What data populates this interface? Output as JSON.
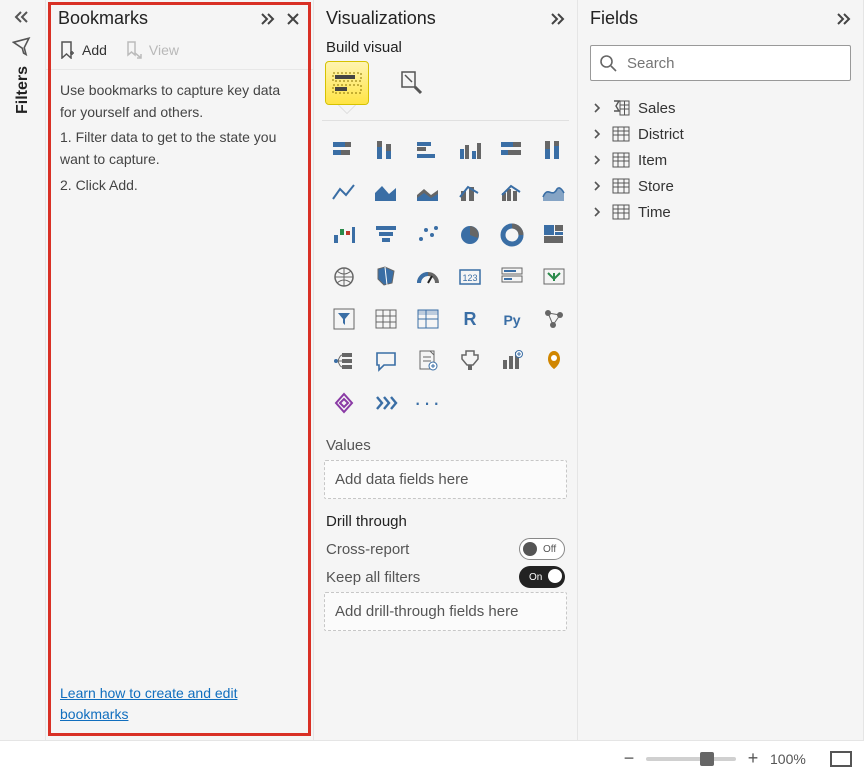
{
  "filters_rail": {
    "label": "Filters"
  },
  "bookmarks": {
    "title": "Bookmarks",
    "add_label": "Add",
    "view_label": "View",
    "hint_intro": "Use bookmarks to capture key data for yourself and others.",
    "hint_step1": "1. Filter data to get to the state you want to capture.",
    "hint_step2": "2. Click Add.",
    "learn_link": "Learn how to create and edit bookmarks"
  },
  "viz": {
    "title": "Visualizations",
    "subtitle": "Build visual",
    "values_label": "Values",
    "values_placeholder": "Add data fields here",
    "drill_label": "Drill through",
    "cross_report_label": "Cross-report",
    "cross_report_state": "Off",
    "keep_filters_label": "Keep all filters",
    "keep_filters_state": "On",
    "drill_placeholder": "Add drill-through fields here",
    "icons": [
      "stacked-bar",
      "stacked-column",
      "clustered-bar",
      "clustered-column",
      "stacked-bar-100",
      "stacked-column-100",
      "line",
      "area",
      "stacked-area",
      "line-stacked-column",
      "line-clustered-column",
      "ribbon",
      "waterfall",
      "funnel",
      "scatter",
      "pie",
      "donut",
      "treemap",
      "map",
      "filled-map",
      "gauge",
      "card",
      "multi-row-card",
      "kpi",
      "slicer",
      "table",
      "matrix",
      "r-visual",
      "py-visual",
      "key-influencers",
      "decomposition",
      "chat",
      "paginated",
      "goals",
      "metrics",
      "narrative",
      "appsource",
      "getmore"
    ]
  },
  "fields": {
    "title": "Fields",
    "search_placeholder": "Search",
    "items": [
      {
        "label": "Sales",
        "icon": "sigma-table"
      },
      {
        "label": "District",
        "icon": "table"
      },
      {
        "label": "Item",
        "icon": "table"
      },
      {
        "label": "Store",
        "icon": "table"
      },
      {
        "label": "Time",
        "icon": "table"
      }
    ]
  },
  "zoom": {
    "percent": "100%"
  }
}
